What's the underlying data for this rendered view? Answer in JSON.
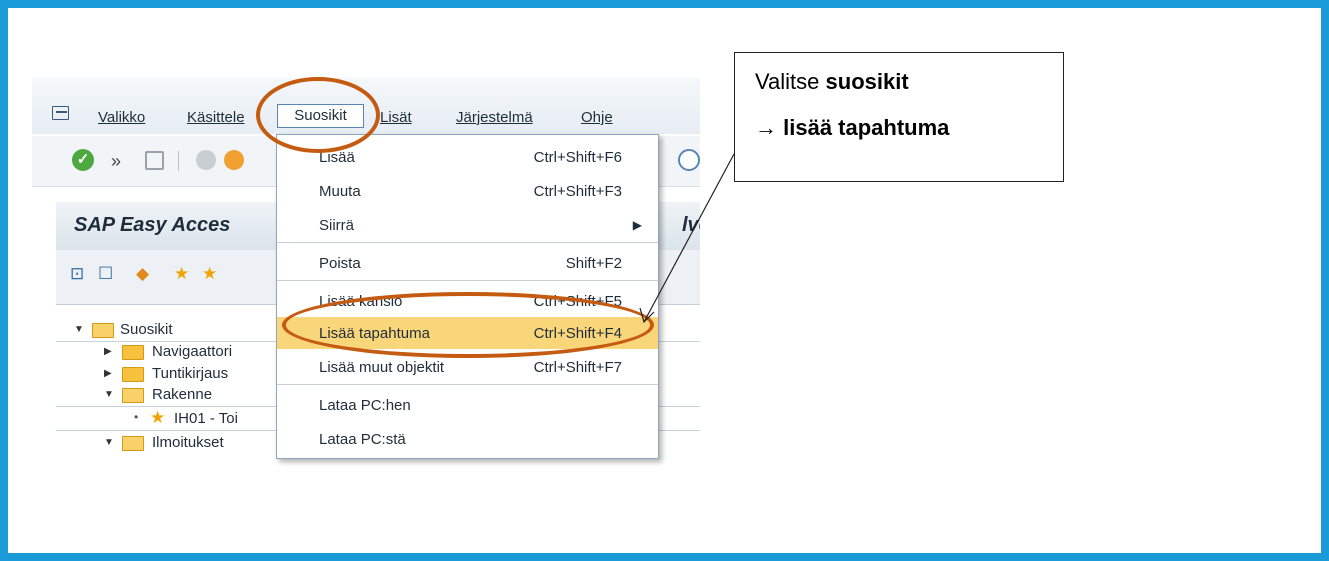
{
  "menubar": {
    "items": [
      "Valikko",
      "Käsittele",
      "Suosikit",
      "Lisät",
      "Järjestelmä",
      "Ohje"
    ],
    "active": "Suosikit"
  },
  "title": {
    "text": "SAP Easy Acces",
    "tail": "lve"
  },
  "dropdown": {
    "items": [
      {
        "label": "Lisää",
        "shortcut": "Ctrl+Shift+F6"
      },
      {
        "label": "Muuta",
        "shortcut": "Ctrl+Shift+F3"
      },
      {
        "label": "Siirrä",
        "shortcut": ""
      },
      {
        "label": "Poista",
        "shortcut": "Shift+F2"
      },
      {
        "label": "Lisää kansio",
        "shortcut": "Ctrl+Shift+F5"
      },
      {
        "label": "Lisää tapahtuma",
        "shortcut": "Ctrl+Shift+F4"
      },
      {
        "label": "Lisää muut objektit",
        "shortcut": "Ctrl+Shift+F7"
      },
      {
        "label": "Lataa PC:hen",
        "shortcut": ""
      },
      {
        "label": "Lataa PC:stä",
        "shortcut": ""
      }
    ],
    "highlighted": "Lisää tapahtuma"
  },
  "tree": {
    "items": [
      {
        "label": "Suosikit"
      },
      {
        "label": "Navigaattori"
      },
      {
        "label": "Tuntikirjaus"
      },
      {
        "label": "Rakenne"
      },
      {
        "label": "IH01 - Toi"
      },
      {
        "label": "Ilmoitukset"
      }
    ]
  },
  "callout": {
    "line1_prefix": "Valitse ",
    "line1_bold": "suosikit",
    "line2_arrow": "→",
    "line2_bold": "lisää tapahtuma"
  },
  "colors": {
    "frame": "#1a9ad6",
    "highlight_oval": "#c55a11",
    "menu_highlight": "#fad67a"
  }
}
